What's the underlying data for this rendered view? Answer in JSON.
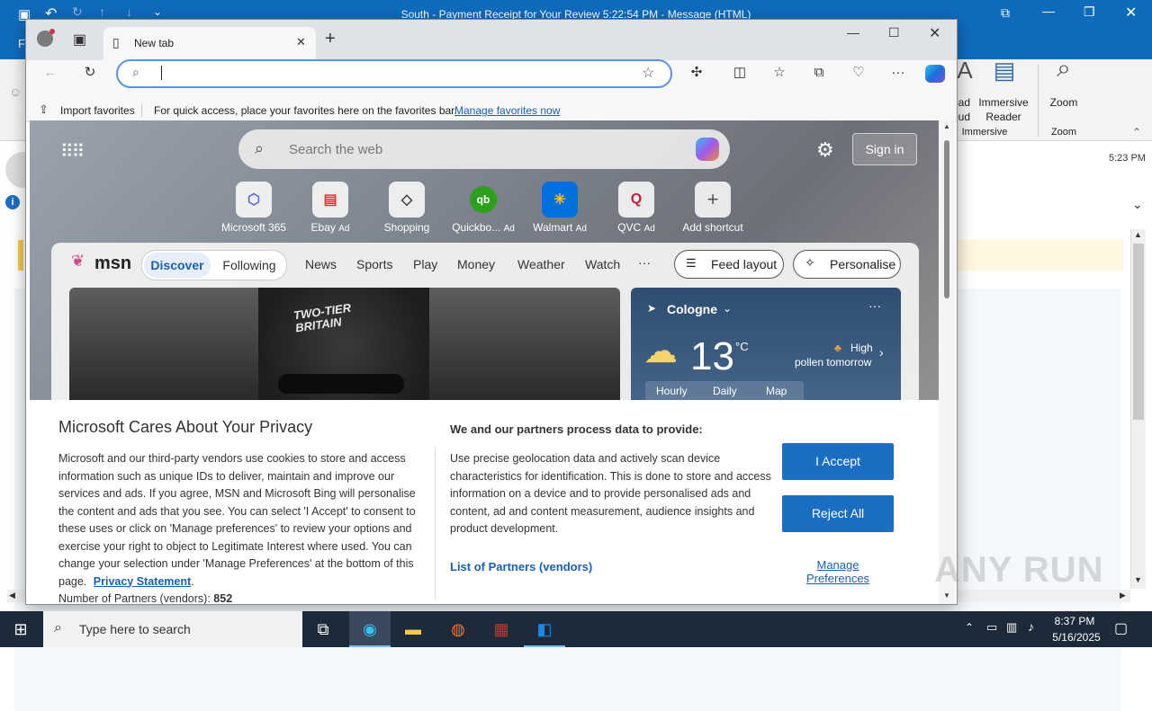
{
  "outlook": {
    "title": "South - Payment Receipt for Your Review 5:22:54 PM  -  Message (HTML)",
    "file_tab": "F",
    "ribbon": {
      "read_aloud": "ead\noud",
      "immersive_reader": "Immersive\nReader",
      "zoom": "Zoom",
      "group_immersive": "Immersive",
      "group_zoom": "Zoom"
    },
    "time": "5:23 PM"
  },
  "edge": {
    "tab_title": "New tab",
    "address_value": "",
    "favbar": {
      "import": "Import favorites",
      "hint": "For quick access, place your favorites here on the favorites bar.",
      "manage": "Manage favorites now"
    }
  },
  "ntp": {
    "search_placeholder": "Search the web",
    "sign_in": "Sign in",
    "shortcuts": [
      {
        "label": "Microsoft 365",
        "ad": "",
        "icon": "microsoft-365-icon",
        "glyph": "⬡"
      },
      {
        "label": "Ebay",
        "ad": "Ad",
        "icon": "ebay-icon",
        "glyph": "▤"
      },
      {
        "label": "Shopping",
        "ad": "",
        "icon": "shopping-tag-icon",
        "glyph": "◇"
      },
      {
        "label": "Quickbo...",
        "ad": "Ad",
        "icon": "quickbooks-icon",
        "glyph": "qb"
      },
      {
        "label": "Walmart",
        "ad": "Ad",
        "icon": "walmart-icon",
        "glyph": "✳"
      },
      {
        "label": "QVC",
        "ad": "Ad",
        "icon": "qvc-icon",
        "glyph": "Q"
      },
      {
        "label": "Add shortcut",
        "ad": "",
        "icon": "add-icon",
        "glyph": "+"
      }
    ],
    "msn": {
      "logo": "msn",
      "tabs": [
        "Discover",
        "Following"
      ],
      "nav": [
        "News",
        "Sports",
        "Play",
        "Money",
        "Weather",
        "Watch",
        "···"
      ],
      "feed_layout": "Feed layout",
      "personalise": "Personalise",
      "hero_text": "TWO-TIER\nBRITAIN",
      "weather": {
        "city": "Cologne",
        "temp": "13",
        "unit": "°C",
        "pollen": "High",
        "pollen_sub": "pollen tomorrow",
        "tabs": [
          "Hourly",
          "Daily",
          "Map"
        ]
      }
    }
  },
  "privacy": {
    "title": "Microsoft Cares About Your Privacy",
    "body": "Microsoft and our third-party vendors use cookies to store and access information such as unique IDs to deliver, maintain and improve our services and ads. If you agree, MSN and Microsoft Bing will personalise the content and ads that you see. You can select 'I Accept' to consent to these uses or click on 'Manage preferences' to review your options and exercise your right to object to Legitimate Interest where used. You can change your selection under 'Manage Preferences' at the bottom of this page.",
    "privacy_link": "Privacy Statement",
    "partners_count_label": "Number of Partners (vendors):",
    "partners_count": "852",
    "right_title": "We and our partners process data to provide:",
    "right_body": "Use precise geolocation data and actively scan device characteristics for identification. This is done to store and access information on a device and to provide personalised ads and content, ad and content measurement, audience insights and product development.",
    "partners_link": "List of Partners (vendors)",
    "accept": "I Accept",
    "reject": "Reject All",
    "manage": "Manage\nPreferences"
  },
  "taskbar": {
    "search_placeholder": "Type here to search",
    "time": "8:37 PM",
    "date": "5/16/2025"
  },
  "watermark": "ANY RUN",
  "colors": {
    "accent": "#0f6cbd",
    "button": "#1b6ec2",
    "link": "#1b5fb0"
  }
}
